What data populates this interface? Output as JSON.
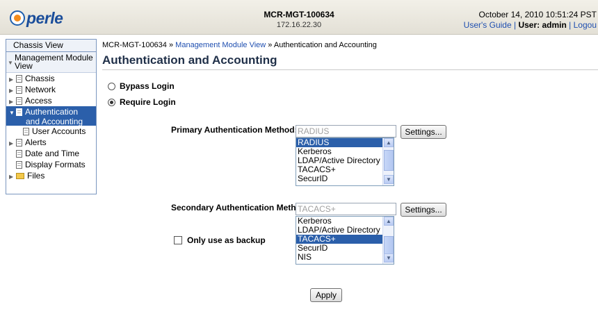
{
  "header": {
    "logo_text": "perle",
    "device_name": "MCR-MGT-100634",
    "device_ip": "172.16.22.30",
    "datetime": "October 14, 2010 10:51:24 PST",
    "users_guide": "User's Guide",
    "separator": "|",
    "user_label": "User: admin",
    "logout": "Logou"
  },
  "nav": {
    "chassis_view": "Chassis View",
    "management_module_view": "Management Module View",
    "items": [
      {
        "label": "Chassis"
      },
      {
        "label": "Network"
      },
      {
        "label": "Access"
      },
      {
        "label": "Authentication",
        "label2": "and Accounting"
      },
      {
        "label": "User Accounts"
      },
      {
        "label": "Alerts"
      },
      {
        "label": "Date and Time"
      },
      {
        "label": "Display Formats"
      },
      {
        "label": "Files"
      }
    ]
  },
  "breadcrumb": {
    "part1": "MCR-MGT-100634",
    "sep": "»",
    "part2": "Management Module View",
    "part3": "Authentication and Accounting"
  },
  "page_title": "Authentication and Accounting",
  "login_mode": {
    "options": [
      "Bypass Login",
      "Require Login"
    ],
    "selected": "Require Login"
  },
  "primary": {
    "label": "Primary Authentication Method:",
    "value": "RADIUS",
    "settings_label": "Settings...",
    "options": [
      "RADIUS",
      "Kerberos",
      "LDAP/Active Directory",
      "TACACS+",
      "SecurID"
    ],
    "selected": "RADIUS"
  },
  "secondary": {
    "label": "Secondary Authentication Method:",
    "value": "TACACS+",
    "settings_label": "Settings...",
    "options": [
      "Kerberos",
      "LDAP/Active Directory",
      "TACACS+",
      "SecurID",
      "NIS"
    ],
    "selected": "TACACS+",
    "backup_label": "Only use as backup",
    "backup_checked": false
  },
  "apply_label": "Apply",
  "colors": {
    "accent": "#2b5faa",
    "link": "#1f4fb0",
    "logo_orange": "#f28c1e"
  }
}
